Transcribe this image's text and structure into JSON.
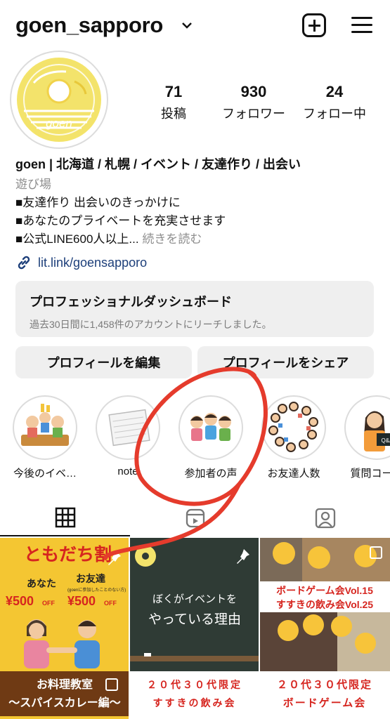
{
  "header": {
    "username": "goen_sapporo"
  },
  "profile": {
    "avatar_text": "goen",
    "stats": [
      {
        "value": "71",
        "label": "投稿"
      },
      {
        "value": "930",
        "label": "フォロワー"
      },
      {
        "value": "24",
        "label": "フォロー中"
      }
    ],
    "bio": {
      "name": "goen | 北海道 / 札幌 / イベント / 友達作り / 出会い",
      "category": "遊び場",
      "lines": [
        "■友達作り 出会いのきっかけに",
        "■あなたのプライベートを充実させます",
        "■公式LINE600人以上..."
      ],
      "more": "続きを読む"
    },
    "link": "lit.link/goensapporo"
  },
  "dashboard": {
    "title": "プロフェッショナルダッシュボード",
    "subtitle": "過去30日間に1,458件のアカウントにリーチしました。"
  },
  "buttons": {
    "edit": "プロフィールを編集",
    "share": "プロフィールをシェア"
  },
  "highlights": [
    {
      "label": "今後のイベ…",
      "icon": "party-illustration"
    },
    {
      "label": "note",
      "icon": "notebook-illustration"
    },
    {
      "label": "参加者の声",
      "icon": "friends-illustration"
    },
    {
      "label": "お友達人数",
      "icon": "people-circle-illustration"
    },
    {
      "label": "質問コーナ",
      "icon": "qa-illustration"
    }
  ],
  "tabs": [
    {
      "name": "grid-icon",
      "active": true
    },
    {
      "name": "reels-icon",
      "active": false
    },
    {
      "name": "tagged-icon",
      "active": false
    }
  ],
  "posts": [
    {
      "headline": "ともだち割",
      "you": "あなた",
      "friend": "お友達",
      "friend_note": "(goenに参加したことのない方)",
      "price_you": "¥500",
      "price_friend": "¥500",
      "off": "OFF",
      "caption_1": "お料理教室",
      "caption_2": "〜スパイスカレー編〜"
    },
    {
      "line_1": "ぼくがイベントを",
      "line_2": "やっている理由",
      "caption_1": "２０代３０代限定",
      "caption_2": "すすきの飲み会"
    },
    {
      "banner_1": "ボードゲーム会Vol.15",
      "banner_2": "すすきの飲み会Vol.25",
      "caption_1": "２０代３０代限定",
      "caption_2": "ボードゲーム会"
    }
  ],
  "colors": {
    "link": "#1d3f7a",
    "annotation": "#e53b2c",
    "tile_yellow": "#f4c632",
    "tile_dark": "#2f3b35"
  }
}
